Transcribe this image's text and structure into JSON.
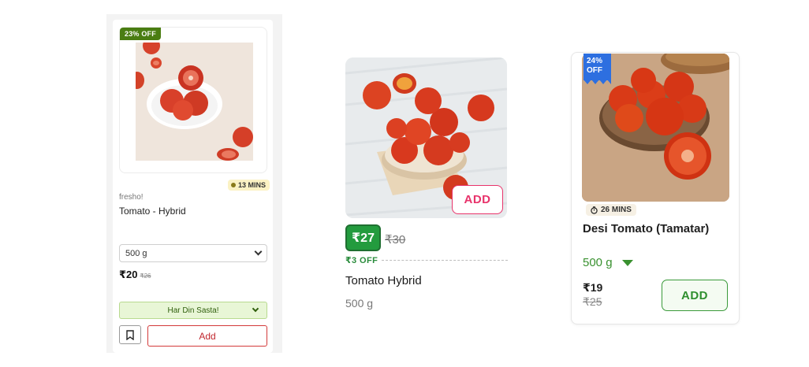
{
  "card1": {
    "discount_badge": "23% OFF",
    "delivery_time": "13 MINS",
    "brand": "fresho!",
    "name": "Tomato - Hybrid",
    "pack_size": "500 g",
    "price": "₹20",
    "mrp": "₹26",
    "offer_label": "Har Din Sasta!",
    "add_label": "Add",
    "icons": [
      "clock-icon",
      "chevron-down-icon",
      "bookmark-icon"
    ],
    "colors": {
      "badge": "#4a7d12",
      "add_border": "#d33a3a",
      "offer_bg": "#e8f6d6"
    }
  },
  "card2": {
    "add_label": "ADD",
    "price": "₹27",
    "mrp": "₹30",
    "discount": "₹3 OFF",
    "name": "Tomato Hybrid",
    "quantity": "500 g",
    "colors": {
      "price_bg": "#239b3e",
      "add_border": "#e8336b"
    }
  },
  "card3": {
    "discount_badge_line1": "24%",
    "discount_badge_line2": "OFF",
    "delivery_time": "26 MINS",
    "name": "Desi Tomato (Tamatar)",
    "quantity": "500 g",
    "price": "₹19",
    "mrp": "₹25",
    "add_label": "ADD",
    "icons": [
      "timer-icon",
      "caret-down-icon"
    ],
    "colors": {
      "badge": "#2d6fe0",
      "add_border": "#3a9a3a",
      "quantity": "#39912f"
    }
  }
}
